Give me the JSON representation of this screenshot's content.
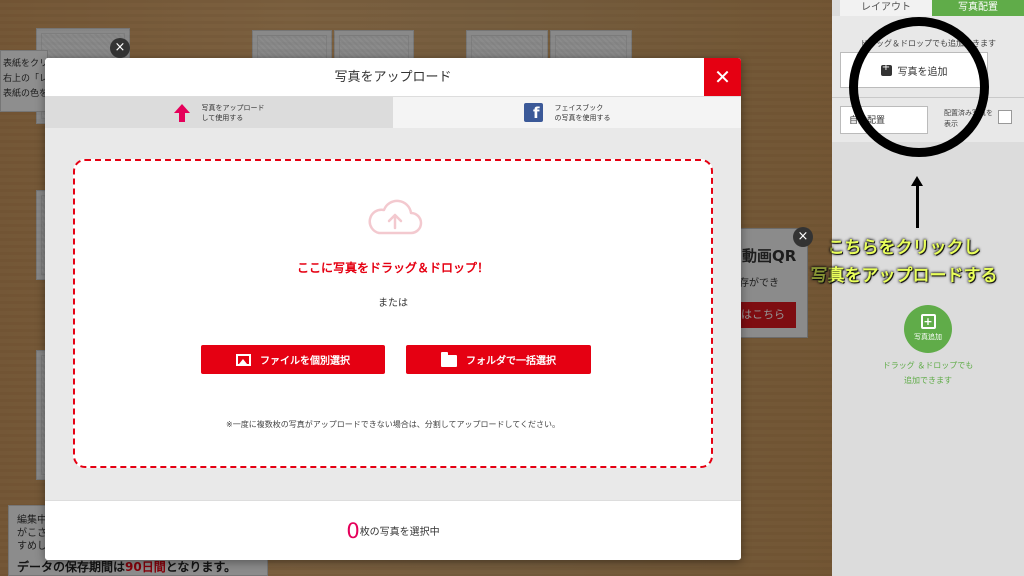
{
  "background": {
    "help_lines": [
      "表紙をクリ",
      "右上の「レ",
      "表紙の色を"
    ],
    "qr_title": "動画QR",
    "qr_sub": "存ができ",
    "qr_button": "はこちら",
    "bottom_lines": [
      "編集中",
      "がこさ",
      "すめし"
    ],
    "storage_prefix": "データの保存期間は",
    "storage_highlight": "90日間",
    "storage_suffix": "となります。",
    "close_symbol": "×"
  },
  "sidebar": {
    "tabs": [
      "レイアウト",
      "写真配置"
    ],
    "hint": "ドラッグ＆ドロップでも追加できます",
    "add_photo": "写真を追加",
    "auto_layout": "自動配置",
    "auto_note": "配置済み写真を表示",
    "circle_label": "写真追加",
    "dd_lines": [
      "ドラッグ ＆ドロップでも",
      "追加できます"
    ]
  },
  "annotation": {
    "lines": [
      "こちらをクリックし",
      "写真をアップロードする"
    ],
    "accent": "#e9ff5a"
  },
  "modal": {
    "title": "写真をアップロード",
    "close_symbol": "✕",
    "tabs": [
      {
        "line1": "写真をアップロード",
        "line2": "して使用する",
        "icon": "upload-arrow-icon"
      },
      {
        "line1": "フェイスブック",
        "line2": "の写真を使用する",
        "icon": "facebook-icon"
      }
    ],
    "dropzone": {
      "title": "ここに写真をドラッグ＆ドロップ！",
      "or": "または",
      "file_button": "ファイルを個別選択",
      "folder_button": "フォルダで一括選択",
      "note": "※一度に複数枚の写真がアップロードできない場合は、分割してアップロードしてください。"
    },
    "footer": {
      "count": "0",
      "label": "枚の写真を選択中"
    },
    "accent": "#e50012"
  }
}
